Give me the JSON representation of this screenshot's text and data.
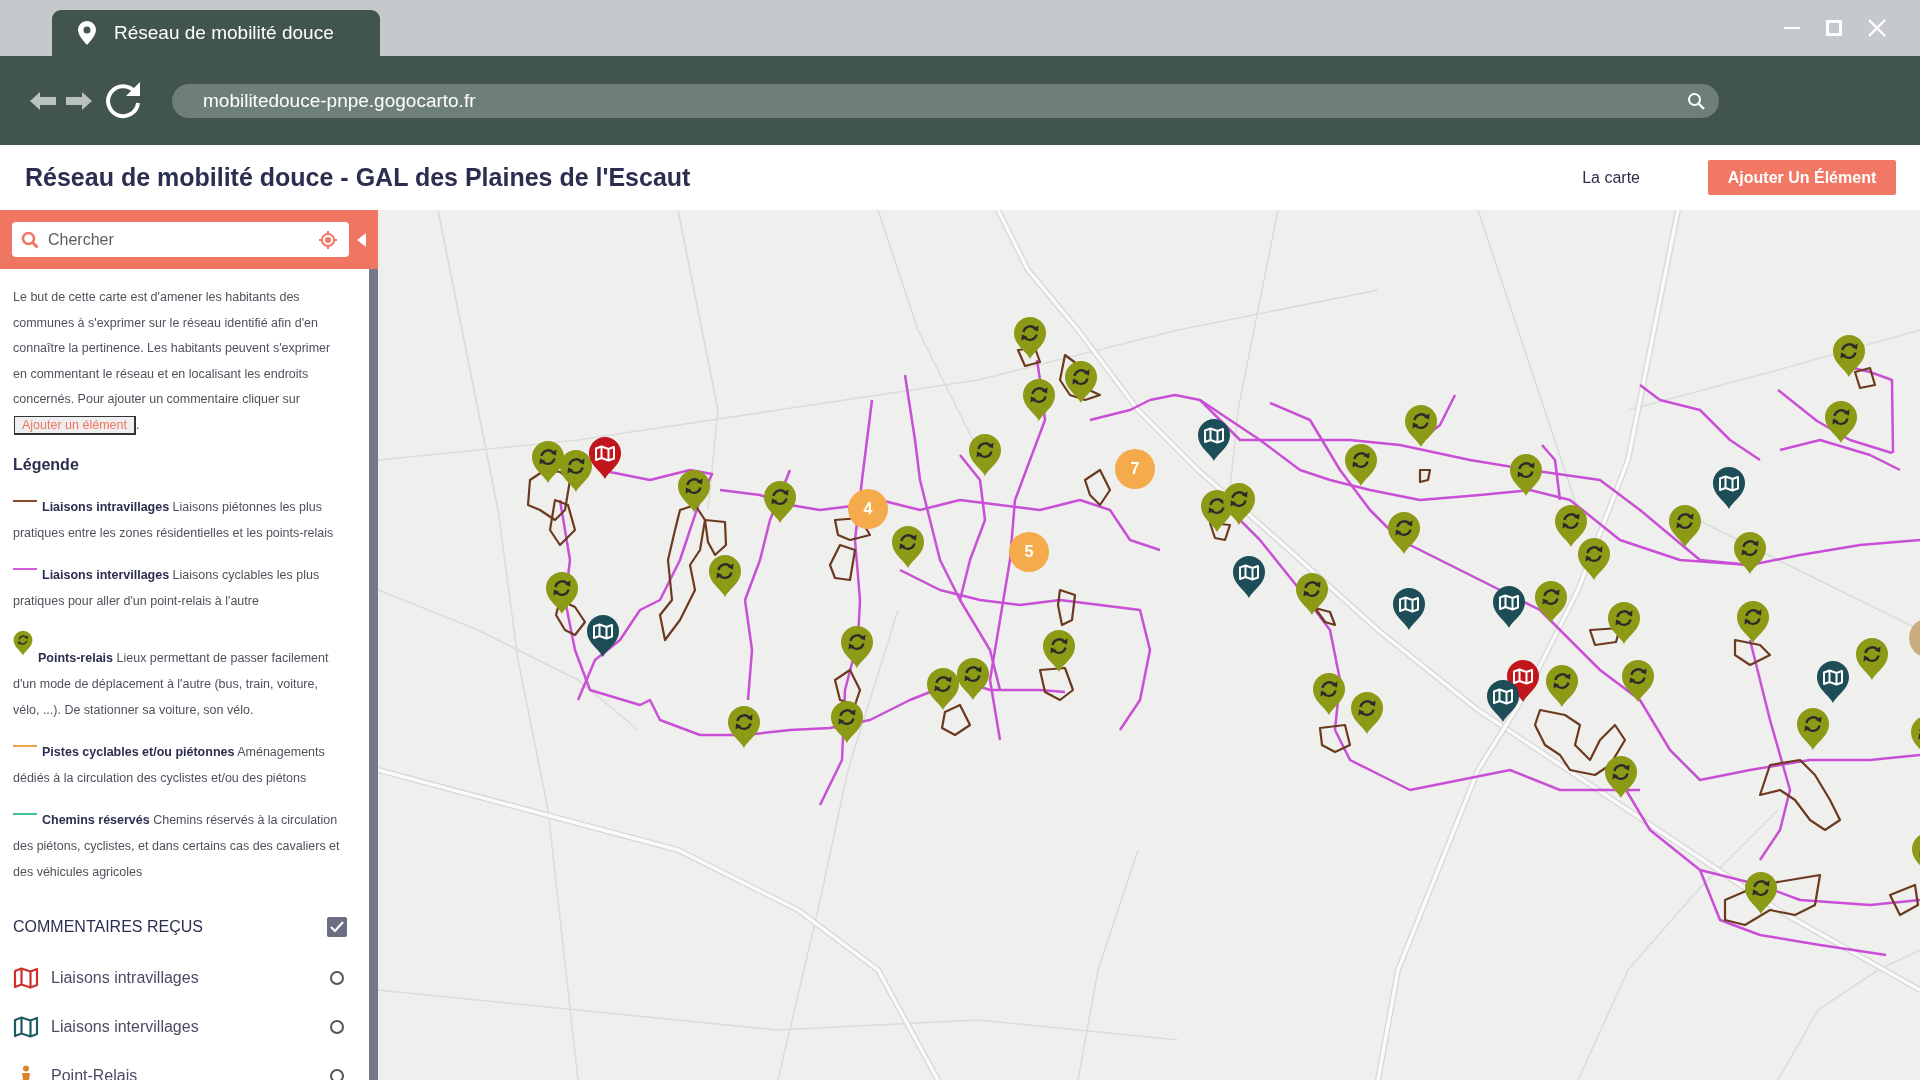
{
  "browser": {
    "tab_title": "Réseau de mobilité douce",
    "url": "mobilitedouce-pnpe.gogocarto.fr"
  },
  "header": {
    "title": "Réseau de mobilité douce - GAL des Plaines de l'Escaut",
    "nav_link": "La carte",
    "add_button": "Ajouter Un Élément"
  },
  "sidebar": {
    "search": {
      "placeholder": "Chercher"
    },
    "intro": {
      "text": "Le but de cette carte est d'amener les habitants des communes à s'exprimer sur le réseau identifié afin d'en connaître la pertinence. Les habitants peuvent s'exprimer en commentant le réseau et en localisant les endroits concernés. Pour ajouter un commentaire cliquer sur",
      "button": "Ajouter un élément",
      "after": "."
    },
    "legend": {
      "title": "Légende",
      "items": [
        {
          "kind": "line",
          "color": "#8b4a2b",
          "text": "**Liaisons intravillages** Liaisons piétonnes les plus pratiques entre les zones résidentielles et les points-relais"
        },
        {
          "kind": "line",
          "color": "#d35ad8",
          "text": "**Liaisons intervillages** Liaisons cyclables les plus pratiques pour aller d'un point-relais à l'autre"
        },
        {
          "kind": "pin",
          "color": "#8c9a16",
          "text": "**Points-relais** Lieux permettant de passer facilement d'un mode de déplacement à l'autre (bus, train, voiture, vélo, ...). De stationner sa voiture, son vélo."
        },
        {
          "kind": "line",
          "color": "#e8a94a",
          "text": "**Pistes cyclables et/ou piétonnes** Aménagements dédiés à la circulation des cyclistes et/ou des piétons"
        },
        {
          "kind": "line",
          "color": "#3fc48f",
          "text": "**Chemins réservés** Chemins réservés à la circulation des piétons, cyclistes, et dans certains cas des cavaliers et des véhicules agricoles"
        }
      ]
    },
    "filters": {
      "title": "COMMENTAIRES REÇUS",
      "checked": true,
      "items": [
        {
          "kind": "map",
          "color": "#d0302c",
          "label": "Liaisons intravillages",
          "checked": false
        },
        {
          "kind": "map",
          "color": "#1f5b63",
          "label": "Liaisons intervillages",
          "checked": false
        },
        {
          "kind": "person",
          "color": "#d9862a",
          "label": "Point-Relais",
          "checked": false
        }
      ]
    }
  },
  "map": {
    "clusters": [
      {
        "count": "4"
      },
      {
        "count": "5"
      },
      {
        "count": "7"
      }
    ],
    "markers": [
      {
        "kind": "relay"
      },
      {
        "kind": "relay"
      },
      {
        "kind": "intra"
      },
      {
        "kind": "relay"
      },
      {
        "kind": "relay"
      },
      {
        "kind": "relay"
      },
      {
        "kind": "relay"
      },
      {
        "kind": "inter"
      },
      {
        "kind": "relay"
      },
      {
        "kind": "relay"
      },
      {
        "kind": "relay"
      },
      {
        "kind": "relay"
      },
      {
        "kind": "relay"
      },
      {
        "kind": "relay"
      },
      {
        "kind": "relay"
      },
      {
        "kind": "relay"
      },
      {
        "kind": "relay"
      },
      {
        "kind": "relay"
      },
      {
        "kind": "relay"
      },
      {
        "kind": "inter"
      },
      {
        "kind": "relay"
      },
      {
        "kind": "relay"
      },
      {
        "kind": "relay"
      },
      {
        "kind": "relay"
      },
      {
        "kind": "relay"
      },
      {
        "kind": "relay"
      },
      {
        "kind": "relay"
      },
      {
        "kind": "relay"
      },
      {
        "kind": "inter"
      },
      {
        "kind": "relay"
      },
      {
        "kind": "inter"
      },
      {
        "kind": "inter"
      },
      {
        "kind": "relay"
      },
      {
        "kind": "relay"
      },
      {
        "kind": "relay"
      },
      {
        "kind": "inter"
      },
      {
        "kind": "relay"
      },
      {
        "kind": "relay"
      },
      {
        "kind": "relay"
      },
      {
        "kind": "relay"
      },
      {
        "kind": "relay"
      },
      {
        "kind": "inter"
      },
      {
        "kind": "relay"
      },
      {
        "kind": "relay"
      },
      {
        "kind": "relay"
      },
      {
        "kind": "intra"
      },
      {
        "kind": "inter"
      },
      {
        "kind": "relay"
      },
      {
        "kind": "relay"
      },
      {
        "kind": "relay"
      },
      {
        "kind": "relay"
      },
      {
        "kind": "relay"
      },
      {
        "kind": "relay"
      },
      {
        "kind": "cluster"
      }
    ]
  }
}
